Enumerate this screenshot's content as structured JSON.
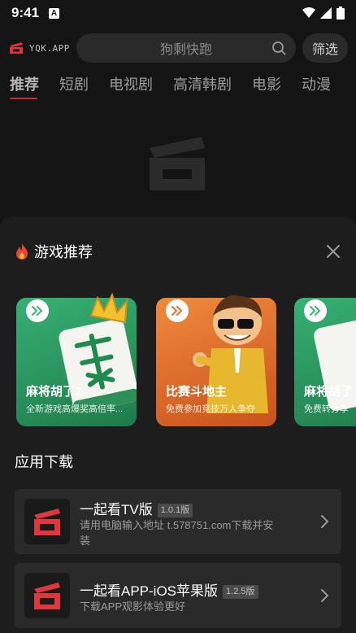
{
  "status_bar": {
    "time": "9:41",
    "notification_letter": "A"
  },
  "header": {
    "logo_text": "YQK.APP",
    "search_placeholder": "狗剩快跑",
    "filter_label": "筛选"
  },
  "tabs": [
    {
      "label": "推荐",
      "active": true
    },
    {
      "label": "短剧",
      "active": false
    },
    {
      "label": "电视剧",
      "active": false
    },
    {
      "label": "高清韩剧",
      "active": false
    },
    {
      "label": "电影",
      "active": false
    },
    {
      "label": "动漫",
      "active": false
    }
  ],
  "sheet": {
    "title": "游戏推荐",
    "games": [
      {
        "name": "麻将胡了2",
        "desc": "全新游戏高爆奖高倍率...",
        "theme": "#2f9a63"
      },
      {
        "name": "比赛斗地主",
        "desc": "免费参加竞技万人争夺",
        "theme": "#e0672b"
      },
      {
        "name": "麻将胡了",
        "desc": "免费转分享",
        "theme": "#2f9a63"
      }
    ],
    "download_title": "应用下载",
    "apps": [
      {
        "name": "一起看TV版",
        "version": "1.0.1版",
        "desc": "请用电脑输入地址 t.578751.com下载并安装"
      },
      {
        "name": "一起看APP-iOS苹果版",
        "version": "1.2.5版",
        "desc": "下载APP观影体验更好"
      }
    ]
  },
  "colors": {
    "accent": "#c4303a",
    "background": "#141414",
    "sheet": "#1d1d1d",
    "card": "#2a2a2a"
  }
}
